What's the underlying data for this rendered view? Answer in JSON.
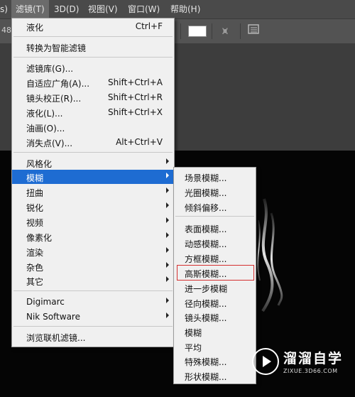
{
  "menubar": {
    "items": [
      {
        "label": "s)"
      },
      {
        "label": "滤镜(T)"
      },
      {
        "label": "3D(D)"
      },
      {
        "label": "视图(V)"
      },
      {
        "label": "窗口(W)"
      },
      {
        "label": "帮助(H)"
      }
    ]
  },
  "toolbar": {
    "left_text": "48"
  },
  "filter_menu": {
    "items": [
      {
        "label": "液化",
        "shortcut": "Ctrl+F"
      },
      {
        "label": "转换为智能滤镜",
        "shortcut": ""
      },
      {
        "label": "滤镜库(G)...",
        "shortcut": ""
      },
      {
        "label": "自适应广角(A)...",
        "shortcut": "Shift+Ctrl+A"
      },
      {
        "label": "镜头校正(R)...",
        "shortcut": "Shift+Ctrl+R"
      },
      {
        "label": "液化(L)...",
        "shortcut": "Shift+Ctrl+X"
      },
      {
        "label": "油画(O)...",
        "shortcut": ""
      },
      {
        "label": "消失点(V)...",
        "shortcut": "Alt+Ctrl+V"
      },
      {
        "label": "风格化"
      },
      {
        "label": "模糊"
      },
      {
        "label": "扭曲"
      },
      {
        "label": "锐化"
      },
      {
        "label": "视频"
      },
      {
        "label": "像素化"
      },
      {
        "label": "渲染"
      },
      {
        "label": "杂色"
      },
      {
        "label": "其它"
      },
      {
        "label": "Digimarc"
      },
      {
        "label": "Nik Software"
      },
      {
        "label": "浏览联机滤镜..."
      }
    ]
  },
  "blur_submenu": {
    "items": [
      {
        "label": "场景模糊..."
      },
      {
        "label": "光圈模糊..."
      },
      {
        "label": "倾斜偏移..."
      },
      {
        "label": "表面模糊..."
      },
      {
        "label": "动感模糊..."
      },
      {
        "label": "方框模糊..."
      },
      {
        "label": "高斯模糊..."
      },
      {
        "label": "进一步模糊"
      },
      {
        "label": "径向模糊..."
      },
      {
        "label": "镜头模糊..."
      },
      {
        "label": "模糊"
      },
      {
        "label": "平均"
      },
      {
        "label": "特殊模糊..."
      },
      {
        "label": "形状模糊..."
      }
    ]
  },
  "watermark": {
    "title": "溜溜自学",
    "url": "ZIXUE.3D66.COM"
  },
  "colors": {
    "highlight": "#1e6cd2",
    "menu_bg": "#f0f0f0",
    "callout": "#d43030"
  }
}
